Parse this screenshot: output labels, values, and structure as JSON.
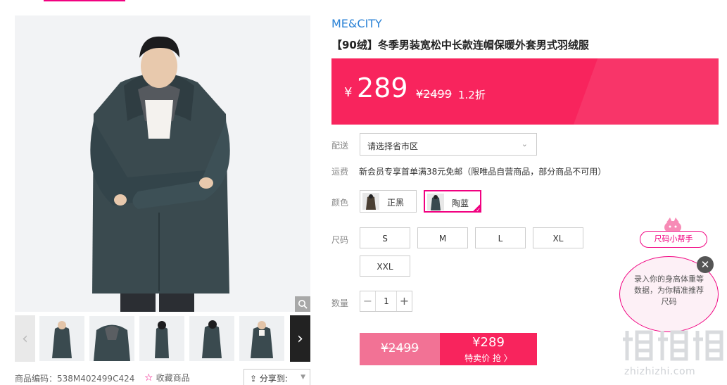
{
  "brand": "ME&CITY",
  "product": {
    "title": "【90绒】冬季男装宽松中长款连帽保暖外套男式羽绒服",
    "currency": "¥",
    "price": "289",
    "original_price": "¥2499",
    "discount": "1.2折"
  },
  "delivery": {
    "label": "配送",
    "placeholder": "请选择省市区"
  },
  "shipping": {
    "label": "运费",
    "text": "新会员专享首单满38元免邮（限唯品自营商品，部分商品不可用）"
  },
  "color": {
    "label": "颜色",
    "options": [
      {
        "name": "正黑",
        "selected": false
      },
      {
        "name": "陶蓝",
        "selected": true
      }
    ]
  },
  "size": {
    "label": "尺码",
    "options": [
      "S",
      "M",
      "L",
      "XL",
      "XXL"
    ]
  },
  "quantity": {
    "label": "数量",
    "value": "1",
    "minus": "−",
    "plus": "+"
  },
  "buy": {
    "original": "¥2499",
    "price": "¥289",
    "action": "特卖价 抢 〉"
  },
  "meta": {
    "code": "商品编码：538M402499C424",
    "favorite": "收藏商品",
    "share": "分享到:"
  },
  "size_helper": {
    "tag": "尺码小帮手",
    "bubble": "录入你的身高体重等数据，为你精准推荐尺码",
    "close": "✕"
  },
  "watermark": "zhizhizhi.com",
  "colors": {
    "accent": "#f10180",
    "price_bg": "#f8245d",
    "brand_blue": "#2a82d6",
    "coat": "#3a4a4f"
  },
  "icons": [
    "zoom-icon",
    "chevron-left-icon",
    "chevron-right-icon",
    "star-icon",
    "share-icon",
    "chevron-down-icon",
    "close-icon",
    "check-icon"
  ]
}
